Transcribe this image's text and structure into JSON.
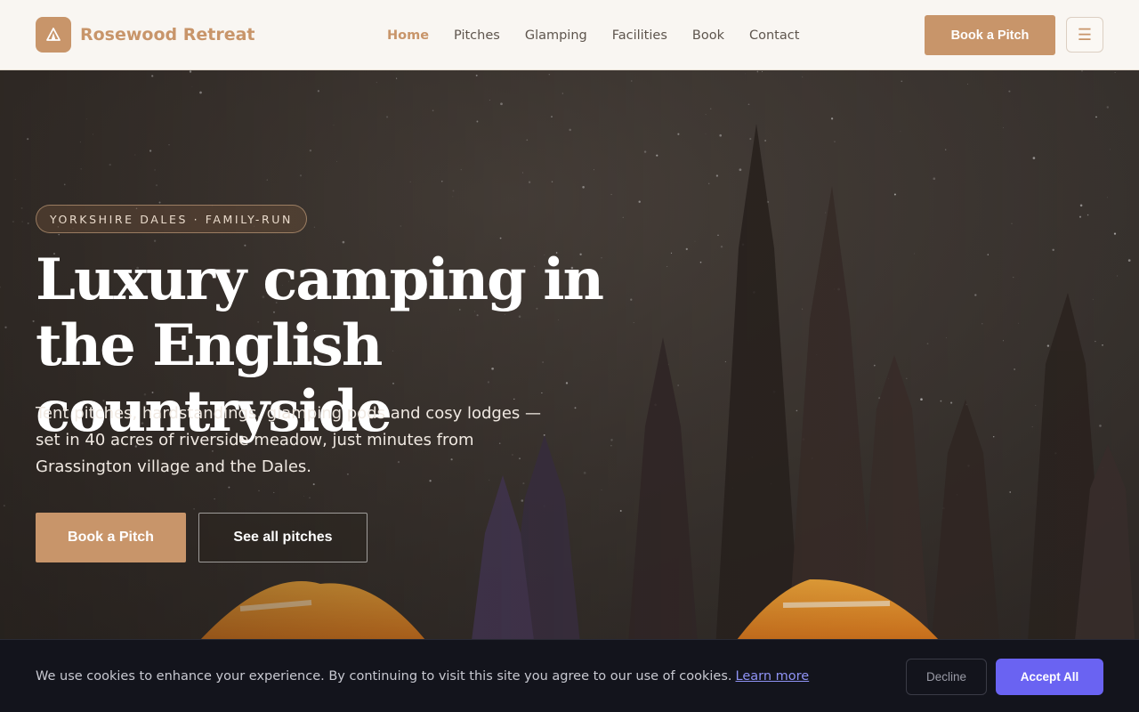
{
  "brand": {
    "name": "Rosewood Retreat",
    "icon": "tent-icon",
    "accent": "#c8956a"
  },
  "nav": {
    "items": [
      {
        "label": "Home",
        "active": true
      },
      {
        "label": "Pitches",
        "active": false
      },
      {
        "label": "Glamping",
        "active": false
      },
      {
        "label": "Facilities",
        "active": false
      },
      {
        "label": "Book",
        "active": false
      },
      {
        "label": "Contact",
        "active": false
      }
    ],
    "cta_label": "Book a Pitch",
    "menu_icon": "☰"
  },
  "hero": {
    "eyebrow": "YORKSHIRE DALES · FAMILY-RUN",
    "title": "Luxury camping in the English countryside",
    "subtitle": "Tent pitches, hardstandings, glamping pods and cosy lodges — set in 40 acres of riverside meadow, just minutes from Grassington village and the Dales.",
    "primary_label": "Book a Pitch",
    "secondary_label": "See all pitches"
  },
  "cookie": {
    "text": "We use cookies to enhance your experience. By continuing to visit this site you agree to our use of cookies.",
    "link_label": "Learn more",
    "decline_label": "Decline",
    "accept_label": "Accept All",
    "accept_color": "#6a63f2"
  }
}
